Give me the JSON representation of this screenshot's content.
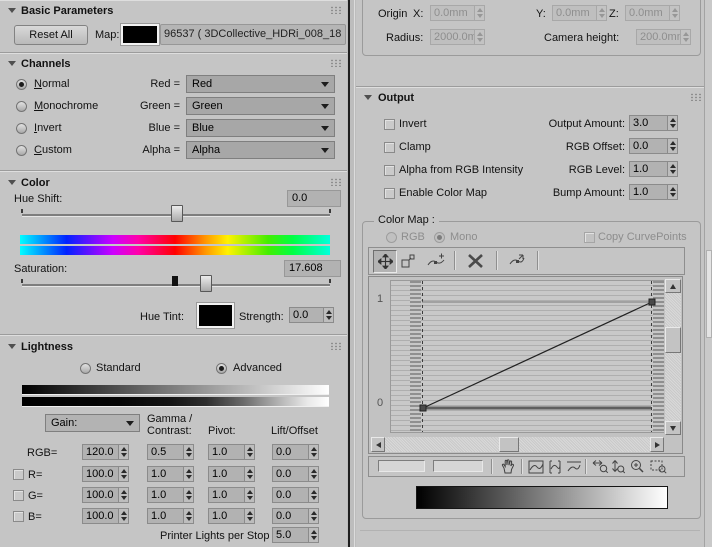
{
  "icons": {
    "rollout-arrow": "▾",
    "dropdown-arrow": "▾",
    "spinner-up": "▲",
    "spinner-down": "▼",
    "grip": "⠿",
    "move": "four-way-arrows",
    "scale-point": "box-with-corner-handle",
    "add-point": "curve-plus-point",
    "delete-point": "✕",
    "reset-curves": "curve-with-arrow",
    "pan-hand": "hand",
    "zoom-extents": "curve-in-box",
    "zoom-horizontal-extents": "curve-in-brackets",
    "zoom-value-extents": "curve-with-bounds",
    "zoom-horizontal": "left-right-arrow-magnifier",
    "zoom-vertical": "up-down-arrow-magnifier",
    "zoom": "magnifier-plus",
    "zoom-region": "dashed-box-magnifier"
  },
  "left": {
    "basic": {
      "title": "Basic Parameters",
      "reset": "Reset All",
      "map_label": "Map:",
      "map_value": "96537 ( 3DCollective_HDRi_008_18"
    },
    "channels": {
      "title": "Channels",
      "modes": [
        {
          "label": "Normal",
          "selected": true
        },
        {
          "label": "Monochrome",
          "selected": false
        },
        {
          "label": "Invert",
          "selected": false
        },
        {
          "label": "Custom",
          "selected": false
        }
      ],
      "maps": [
        {
          "label": "Red =",
          "value": "Red"
        },
        {
          "label": "Green =",
          "value": "Green"
        },
        {
          "label": "Blue =",
          "value": "Blue"
        },
        {
          "label": "Alpha =",
          "value": "Alpha"
        }
      ]
    },
    "color": {
      "title": "Color",
      "hue_label": "Hue Shift:",
      "hue_value": "0.0",
      "sat_label": "Saturation:",
      "sat_value": "17.608",
      "tint_label": "Hue Tint:",
      "strength_label": "Strength:",
      "strength_value": "0.0"
    },
    "lightness": {
      "title": "Lightness",
      "standard": "Standard",
      "advanced": "Advanced",
      "gain": "Gain:",
      "hdr_gamma_1": "Gamma /",
      "hdr_gamma_2": "Contrast:",
      "hdr_pivot": "Pivot:",
      "hdr_lift": "Lift/Offset",
      "rows": [
        {
          "label": "RGB=",
          "gain": "120.0",
          "gamma": "0.5",
          "pivot": "1.0",
          "lift": "0.0"
        },
        {
          "label": "R=",
          "gain": "100.0",
          "gamma": "1.0",
          "pivot": "1.0",
          "lift": "0.0"
        },
        {
          "label": "G=",
          "gain": "100.0",
          "gamma": "1.0",
          "pivot": "1.0",
          "lift": "0.0"
        },
        {
          "label": "B=",
          "gain": "100.0",
          "gamma": "1.0",
          "pivot": "1.0",
          "lift": "0.0"
        }
      ],
      "printer_label": "Printer Lights per Stop",
      "printer_value": "5.0"
    }
  },
  "right": {
    "position": {
      "origin_label": "Origin",
      "x_label": "X:",
      "x_value": "0.0mm",
      "y_label": "Y:",
      "y_value": "0.0mm",
      "z_label": "Z:",
      "z_value": "0.0mm",
      "radius_label": "Radius:",
      "radius_value": "2000.0mm",
      "camera_label": "Camera height:",
      "camera_value": "200.0mm"
    },
    "output": {
      "title": "Output",
      "checks": [
        "Invert",
        "Clamp",
        "Alpha from RGB Intensity",
        "Enable Color Map"
      ],
      "spins": [
        {
          "label": "Output Amount:",
          "value": "3.0"
        },
        {
          "label": "RGB Offset:",
          "value": "0.0"
        },
        {
          "label": "RGB Level:",
          "value": "1.0"
        },
        {
          "label": "Bump Amount:",
          "value": "1.0"
        }
      ],
      "color_map": {
        "group_label": "Color Map :",
        "rgb": "RGB",
        "mono": "Mono",
        "copy": "Copy CurvePoints",
        "y_max": "1",
        "y_min": "0",
        "curve_points": [
          {
            "x": 0,
            "y": 0
          },
          {
            "x": 1,
            "y": 1
          }
        ],
        "toolbar_icons": [
          "move",
          "scale-point",
          "add-point",
          "delete-point",
          "reset-curves"
        ],
        "bottom_icons": [
          "pan-hand",
          "zoom-extents",
          "zoom-horizontal-extents",
          "zoom-value-extents",
          "zoom-horizontal",
          "zoom-vertical",
          "zoom",
          "zoom-region"
        ],
        "field1": "",
        "field2": ""
      }
    }
  }
}
